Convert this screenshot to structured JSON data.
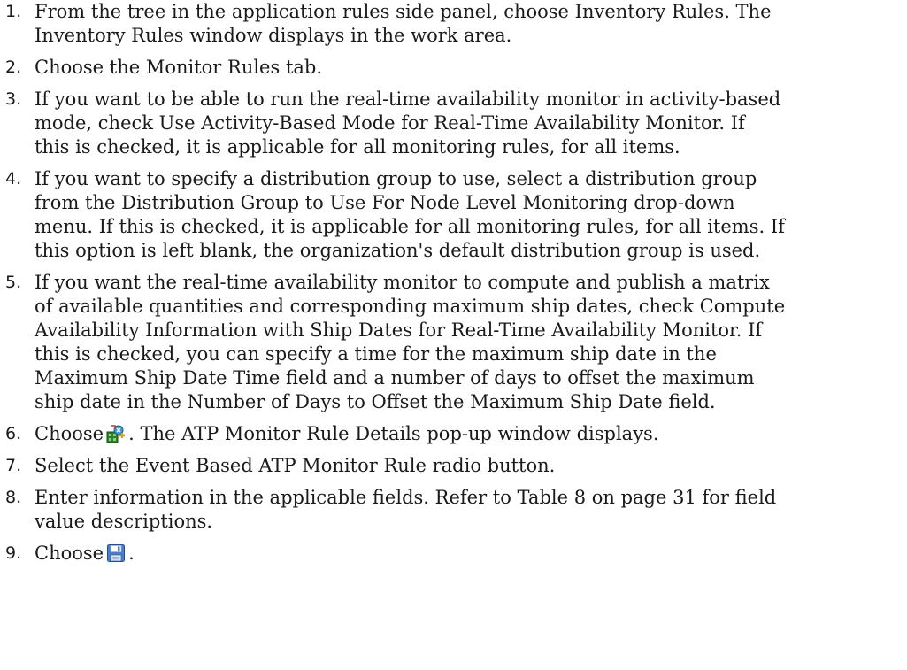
{
  "steps": [
    {
      "number": "1.",
      "lines": [
        "From the tree in the application rules side panel, choose Inventory Rules. The",
        "Inventory Rules window displays in the work area."
      ]
    },
    {
      "number": "2.",
      "lines": [
        "Choose the Monitor Rules tab."
      ]
    },
    {
      "number": "3.",
      "lines": [
        "If you want to be able to run the real-time availability monitor in activity-based",
        "mode, check Use Activity-Based Mode for Real-Time Availability Monitor. If",
        "this is checked, it is applicable for all monitoring rules, for all items."
      ]
    },
    {
      "number": "4.",
      "lines": [
        "If you want to specify a distribution group to use, select a distribution group",
        "from the Distribution Group to Use For Node Level Monitoring drop-down",
        "menu. If this is checked, it is applicable for all monitoring rules, for all items. If",
        "this option is left blank, the organization's default distribution group is used."
      ]
    },
    {
      "number": "5.",
      "lines": [
        "If you want the real-time availability monitor to compute and publish a matrix",
        "of available quantities and corresponding maximum ship dates, check Compute",
        "Availability Information with Ship Dates for Real-Time Availability Monitor. If",
        "this is checked, you can specify a time for the maximum ship date in the",
        "Maximum Ship Date Time field and a number of days to offset the maximum",
        "ship date in the Number of Days to Offset the Maximum Ship Date field."
      ]
    },
    {
      "number": "6.",
      "before_icon": "Choose",
      "icon": "add-rule-icon",
      "after_icon": ". The ATP Monitor Rule Details pop-up window displays."
    },
    {
      "number": "7.",
      "lines": [
        "Select the Event Based ATP Monitor Rule radio button."
      ]
    },
    {
      "number": "8.",
      "lines": [
        "Enter information in the applicable fields. Refer to Table 8 on page 31 for field",
        "value descriptions."
      ]
    },
    {
      "number": "9.",
      "before_icon": "Choose",
      "icon": "save-icon",
      "after_icon": "."
    }
  ]
}
